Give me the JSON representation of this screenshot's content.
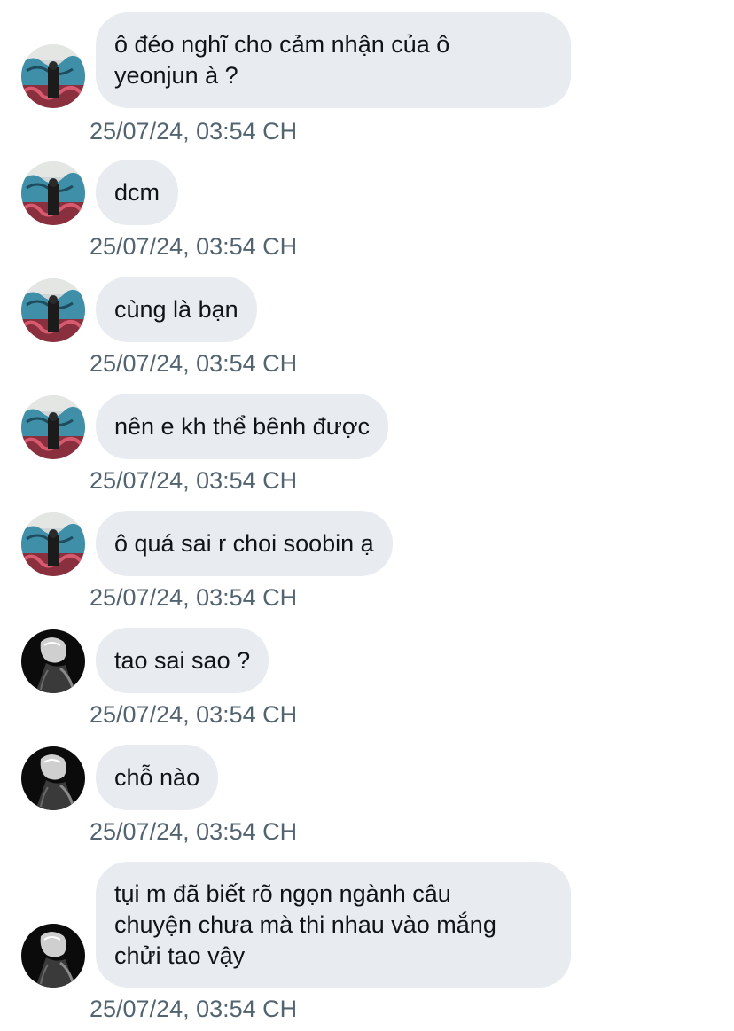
{
  "conversation": {
    "messages": [
      {
        "sender": "other-a",
        "avatar": "user-avatar-graffiti",
        "text": "ô đéo nghĩ cho cảm nhận của ô\nyeonjun à ?",
        "timestamp": "25/07/24, 03:54 CH"
      },
      {
        "sender": "other-a",
        "avatar": "user-avatar-graffiti",
        "text": "dcm",
        "timestamp": "25/07/24, 03:54 CH"
      },
      {
        "sender": "other-a",
        "avatar": "user-avatar-graffiti",
        "text": "cùng là bạn",
        "timestamp": "25/07/24, 03:54 CH"
      },
      {
        "sender": "other-a",
        "avatar": "user-avatar-graffiti",
        "text": "nên e kh thể bênh được",
        "timestamp": "25/07/24, 03:54 CH"
      },
      {
        "sender": "other-a",
        "avatar": "user-avatar-graffiti",
        "text": "ô quá sai r choi soobin ạ",
        "timestamp": "25/07/24, 03:54 CH"
      },
      {
        "sender": "other-b",
        "avatar": "user-avatar-dark-portrait",
        "text": "tao sai sao ?",
        "timestamp": "25/07/24, 03:54 CH"
      },
      {
        "sender": "other-b",
        "avatar": "user-avatar-dark-portrait",
        "text": "chỗ nào",
        "timestamp": "25/07/24, 03:54 CH"
      },
      {
        "sender": "other-b",
        "avatar": "user-avatar-dark-portrait",
        "text": "tụi m đã biết rõ ngọn ngành câu\nchuyện chưa mà thi nhau vào mắng\nchửi tao vậy",
        "timestamp": "25/07/24, 03:54 CH"
      }
    ]
  },
  "colors": {
    "bubble_bg": "#e8ecf0",
    "text": "#0f1419",
    "timestamp": "#536471",
    "background": "#ffffff"
  }
}
